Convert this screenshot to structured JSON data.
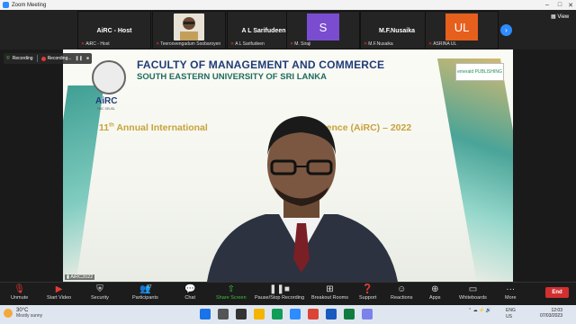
{
  "window": {
    "title": "Zoom Meeting",
    "view_label": "View"
  },
  "participants": [
    {
      "display": "AiRC - Host",
      "caption": "AiRC - Host",
      "type": "name",
      "muted": true
    },
    {
      "display": "",
      "caption": "Teeroovengadum Soobaroyen",
      "type": "photo",
      "muted": true
    },
    {
      "display": "A L Sarifudeen",
      "caption": "A L Sarifudeen",
      "type": "name",
      "muted": true
    },
    {
      "display": "S",
      "caption": "M. Siraji",
      "type": "letter",
      "color": "#7a4dd0",
      "muted": true
    },
    {
      "display": "M.F.Nusaika",
      "caption": "M.F.Nusaika",
      "type": "name",
      "muted": true
    },
    {
      "display": "UL",
      "caption": "ASRINA UL",
      "type": "letter",
      "color": "#e65f1c",
      "muted": true
    }
  ],
  "recording": {
    "left_label": "Recording",
    "status": "Recording...",
    "pause_icon": "pause-icon",
    "stop_icon": "stop-icon"
  },
  "video": {
    "slide_title": "FACULTY OF MANAGEMENT AND COMMERCE",
    "slide_subtitle": "SOUTH EASTERN UNIVERSITY OF SRI LANKA",
    "conference_prefix": "11",
    "conference_sup": "th",
    "conference_left": "Annual International",
    "conference_right": "nference (AiRC) – 2022",
    "logo_text": "AiRC",
    "logo_sub": "FMC SEUSL",
    "publisher": "emerald PUBLISHING",
    "speaker_label": "AiRC2022"
  },
  "toolbar": {
    "unmute": "Unmute",
    "start_video": "Start Video",
    "security": "Security",
    "participants": "Participants",
    "participant_count": "77",
    "chat": "Chat",
    "share_screen": "Share Screen",
    "pause_stop": "Pause/Stop Recording",
    "breakout": "Breakout Rooms",
    "support": "Support",
    "reactions": "Reactions",
    "apps": "Apps",
    "whiteboards": "Whiteboards",
    "more": "More",
    "end": "End"
  },
  "taskbar": {
    "temp": "30°C",
    "condition": "Mostly sunny",
    "lang1": "ENG",
    "lang2": "US",
    "time": "12:03",
    "date": "07/03/2023"
  }
}
